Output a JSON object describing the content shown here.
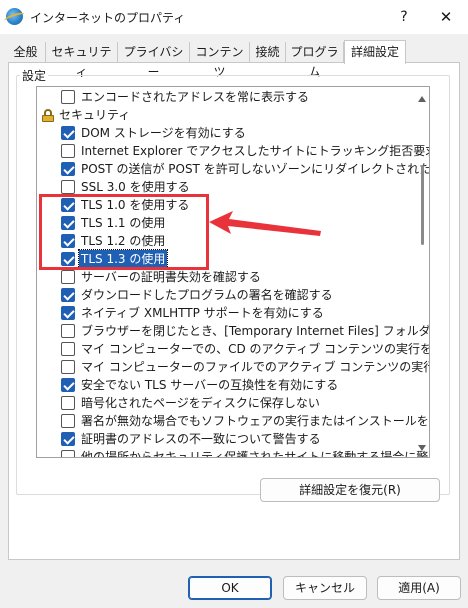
{
  "window": {
    "title": "インターネットのプロパティ",
    "help": "?",
    "close": "✕"
  },
  "tabs": [
    "全般",
    "セキュリティ",
    "プライバシー",
    "コンテンツ",
    "接続",
    "プログラム",
    "詳細設定"
  ],
  "active_tab": "詳細設定",
  "settings_group_label": "設定",
  "settings": [
    {
      "label": "エンコードされたアドレスを常に表示する",
      "checked": false
    },
    {
      "label": "セキュリティ",
      "category": true
    },
    {
      "label": "DOM ストレージを有効にする",
      "checked": true
    },
    {
      "label": "Internet Explorer でアクセスしたサイトにトラッキング拒否要求を送信す",
      "checked": false
    },
    {
      "label": "POST の送信が POST を許可しないゾーンにリダイレクトされた場合に警告",
      "checked": true
    },
    {
      "label": "SSL 3.0 を使用する",
      "checked": false
    },
    {
      "label": "TLS 1.0 を使用する",
      "checked": true
    },
    {
      "label": "TLS 1.1 の使用",
      "checked": true
    },
    {
      "label": "TLS 1.2 の使用",
      "checked": true
    },
    {
      "label": "TLS 1.3 の使用",
      "checked": true,
      "selected": true
    },
    {
      "label": "サーバーの証明書失効を確認する",
      "checked": false
    },
    {
      "label": "ダウンロードしたプログラムの署名を確認する",
      "checked": true
    },
    {
      "label": "ネイティブ XMLHTTP サポートを有効にする",
      "checked": true
    },
    {
      "label": "ブラウザーを閉じたとき、[Temporary Internet Files] フォルダーを空にする",
      "checked": false
    },
    {
      "label": "マイ コンピューターでの、CD のアクティブ コンテンツの実行を許可する",
      "checked": false
    },
    {
      "label": "マイ コンピューターのファイルでのアクティブ コンテンツの実行を許可する",
      "checked": false
    },
    {
      "label": "安全でない TLS サーバーの互換性を有効にする",
      "checked": true
    },
    {
      "label": "暗号化されたページをディスクに保存しない",
      "checked": false
    },
    {
      "label": "署名が無効な場合でもソフトウェアの実行またはインストールを許可する",
      "checked": false
    },
    {
      "label": "証明書のアドレスの不一致について警告する",
      "checked": true
    },
    {
      "label": "他の場所からセキュリティ保護されたサイトに移動する場合に警告する",
      "checked": false
    }
  ],
  "buttons": {
    "restore": "詳細設定を復元(R)",
    "ok": "OK",
    "cancel": "キャンセル",
    "apply": "適用(A)"
  },
  "colors": {
    "accent": "#1f5fb4",
    "highlight_box": "#e8333a"
  }
}
